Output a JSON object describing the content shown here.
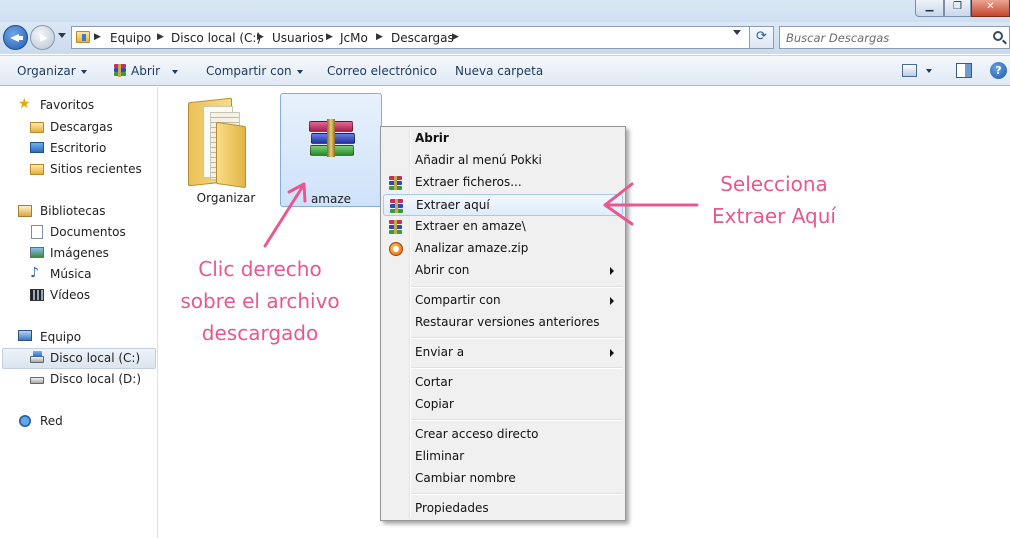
{
  "address": {
    "breadcrumbs": [
      "Equipo",
      "Disco local (C:)",
      "Usuarios",
      "JcMo",
      "Descargas"
    ]
  },
  "search": {
    "placeholder": "Buscar Descargas"
  },
  "toolbar": {
    "organize": "Organizar",
    "open": "Abrir",
    "share": "Compartir con",
    "email": "Correo electrónico",
    "new_folder": "Nueva carpeta"
  },
  "sidebar": {
    "favorites": "Favoritos",
    "downloads": "Descargas",
    "desktop": "Escritorio",
    "recent": "Sitios recientes",
    "libraries": "Bibliotecas",
    "documents": "Documentos",
    "images": "Imágenes",
    "music": "Música",
    "videos": "Vídeos",
    "computer": "Equipo",
    "drive_c": "Disco local (C:)",
    "drive_d": "Disco local (D:)",
    "network": "Red"
  },
  "files": [
    {
      "name": "Organizar",
      "type": "folder"
    },
    {
      "name": "amaze",
      "type": "archive"
    }
  ],
  "context_menu": {
    "items": [
      "Abrir",
      "Añadir al menú Pokki",
      "Extraer ficheros...",
      "Extraer aquí",
      "Extraer en amaze\\",
      "Analizar amaze.zip",
      "Abrir con",
      "Compartir con",
      "Restaurar versiones anteriores",
      "Enviar a",
      "Cortar",
      "Copiar",
      "Crear acceso directo",
      "Eliminar",
      "Cambiar nombre",
      "Propiedades"
    ],
    "highlighted": "Extraer aquí"
  },
  "annotations": {
    "left": [
      "Clic derecho",
      "sobre el archivo",
      "descargado"
    ],
    "right": [
      "Selecciona",
      "Extraer Aquí"
    ],
    "color": "#e8578f"
  },
  "colors": {
    "selection_border": "#84acdd",
    "command_text": "#1e395b"
  }
}
